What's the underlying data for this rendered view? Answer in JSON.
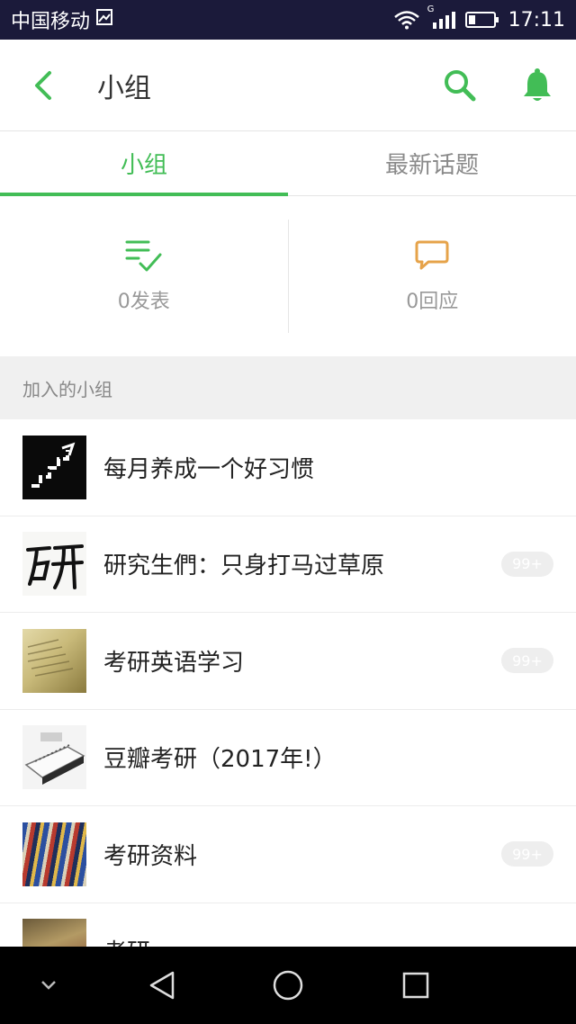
{
  "status_bar": {
    "carrier": "中国移动",
    "network_label": "G",
    "time": "17:11"
  },
  "app_bar": {
    "title": "小组",
    "accent_color": "#42bd56"
  },
  "tabs": [
    {
      "label": "小组",
      "active": true
    },
    {
      "label": "最新话题",
      "active": false
    }
  ],
  "stats": {
    "posts_label": "0发表",
    "replies_label": "0回应",
    "posts_icon": "list-check-icon",
    "replies_icon": "chat-bubble-icon"
  },
  "section": {
    "title": "加入的小组"
  },
  "groups": [
    {
      "name": "每月养成一个好习惯",
      "badge": "",
      "thumb": "stairs-thumbnail"
    },
    {
      "name": "研究生們：只身打马过草原",
      "badge": "99+",
      "thumb": "calligraphy-thumbnail"
    },
    {
      "name": "考研英语学习",
      "badge": "99+",
      "thumb": "book-thumbnail"
    },
    {
      "name": "豆瓣考研（2017年!）",
      "badge": "",
      "thumb": "notebook-thumbnail"
    },
    {
      "name": "考研资料",
      "badge": "99+",
      "thumb": "bookshelf-thumbnail"
    },
    {
      "name": "考研",
      "badge": "",
      "thumb": "painting-thumbnail"
    }
  ]
}
